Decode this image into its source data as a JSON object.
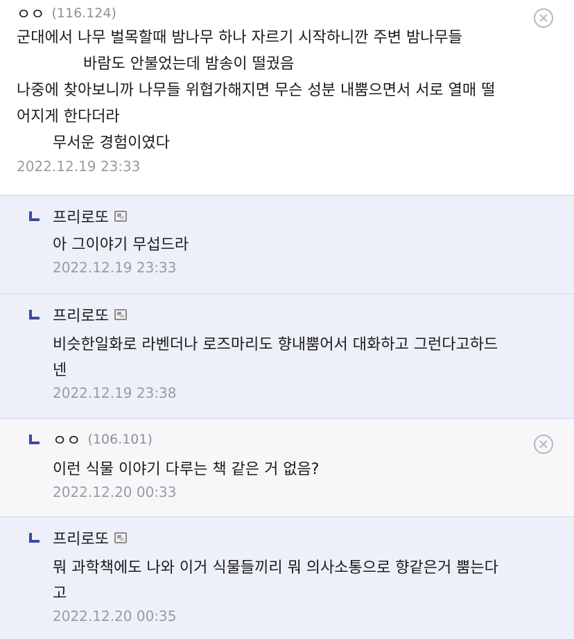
{
  "comments": [
    {
      "nick": "ㅇㅇ",
      "ip": "(116.124)",
      "lines": [
        "군대에서 나무 벌목할때 밤나무 하나 자르기 시작하니깐 주변 밤나무들",
        "바람도 안불었는데 밤송이 떨궜음",
        "나중에 찾아보니까 나무들 위협가해지면 무슨 성분 내뿜으면서 서로 열매 떨",
        "어지게 한다더라",
        "무서운 경험이였다"
      ],
      "time": "2022.12.19 23:33"
    },
    {
      "nick": "프리로또",
      "text": "아 그이야기 무섭드라",
      "time": "2022.12.19 23:33"
    },
    {
      "nick": "프리로또",
      "text": "비슷한일화로 라벤더나 로즈마리도 향내뿜어서 대화하고 그런다고하드넨",
      "text_line1": "비슷한일화로 라벤더나 로즈마리도 향내뿜어서 대화하고 그런다고하드",
      "text_line2": "넨",
      "time": "2022.12.19 23:38"
    },
    {
      "nick": "ㅇㅇ",
      "ip": "(106.101)",
      "text": "이런 식물 이야기 다루는 책 같은 거 없음?",
      "time": "2022.12.20 00:33"
    },
    {
      "nick": "프리로또",
      "text_line1": "뭐 과학책에도 나와 이거 식물들끼리 뭐 의사소통으로 향같은거 뿜는다",
      "text_line2": "고",
      "time": "2022.12.20 00:35"
    }
  ]
}
